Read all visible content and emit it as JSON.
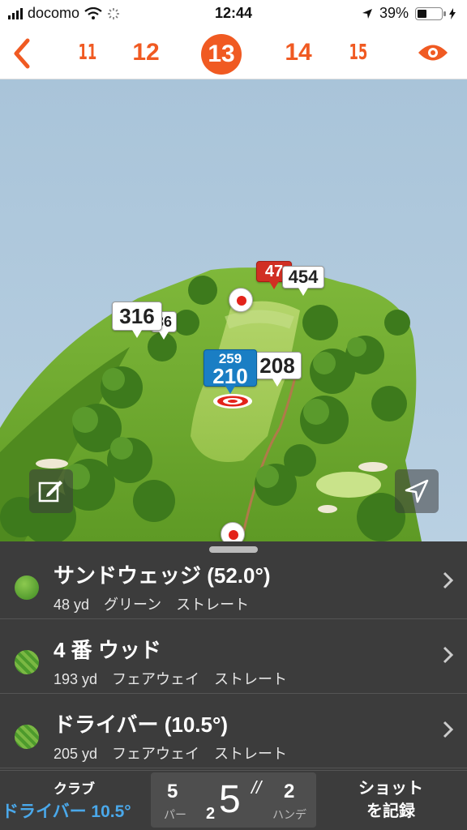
{
  "status_bar": {
    "carrier": "docomo",
    "time": "12:44",
    "battery": "39%",
    "battery_level": 0.39
  },
  "hole_nav": {
    "holes": [
      "11",
      "12",
      "13",
      "14",
      "15"
    ],
    "current": "13",
    "back_icon": "chevron-left-icon",
    "view_icon": "eye-icon"
  },
  "map": {
    "distance_markers": [
      "316",
      "36",
      "47",
      "454",
      "208"
    ],
    "target_distance": {
      "top": "259",
      "main": "210"
    },
    "icons": [
      "pencil-icon",
      "location-arrow-icon"
    ]
  },
  "clubs": [
    {
      "name": "サンドウェッジ (52.0°)",
      "distance": "48 yd",
      "lie": "グリーン",
      "shape": "ストレート"
    },
    {
      "name": "4 番 ウッド",
      "distance": "193 yd",
      "lie": "フェアウェイ",
      "shape": "ストレート"
    },
    {
      "name": "ドライバー (10.5°)",
      "distance": "205 yd",
      "lie": "フェアウェイ",
      "shape": "ストレート"
    }
  ],
  "bottom_bar": {
    "club_label": "クラブ",
    "club_value": "ドライバー 10.5°",
    "par": "5",
    "par_label": "パー",
    "putts": "2",
    "score": "5",
    "score_mark": "//",
    "handicap": "2",
    "handicap_label": "ハンデ",
    "record_line1": "ショット",
    "record_line2": "を記録"
  },
  "colors": {
    "accent": "#f05a22",
    "panel": "#3c3c3c",
    "club_value": "#4aa8ea",
    "target_bubble": "#1a7ec4",
    "alert_bubble": "#d12f23"
  }
}
